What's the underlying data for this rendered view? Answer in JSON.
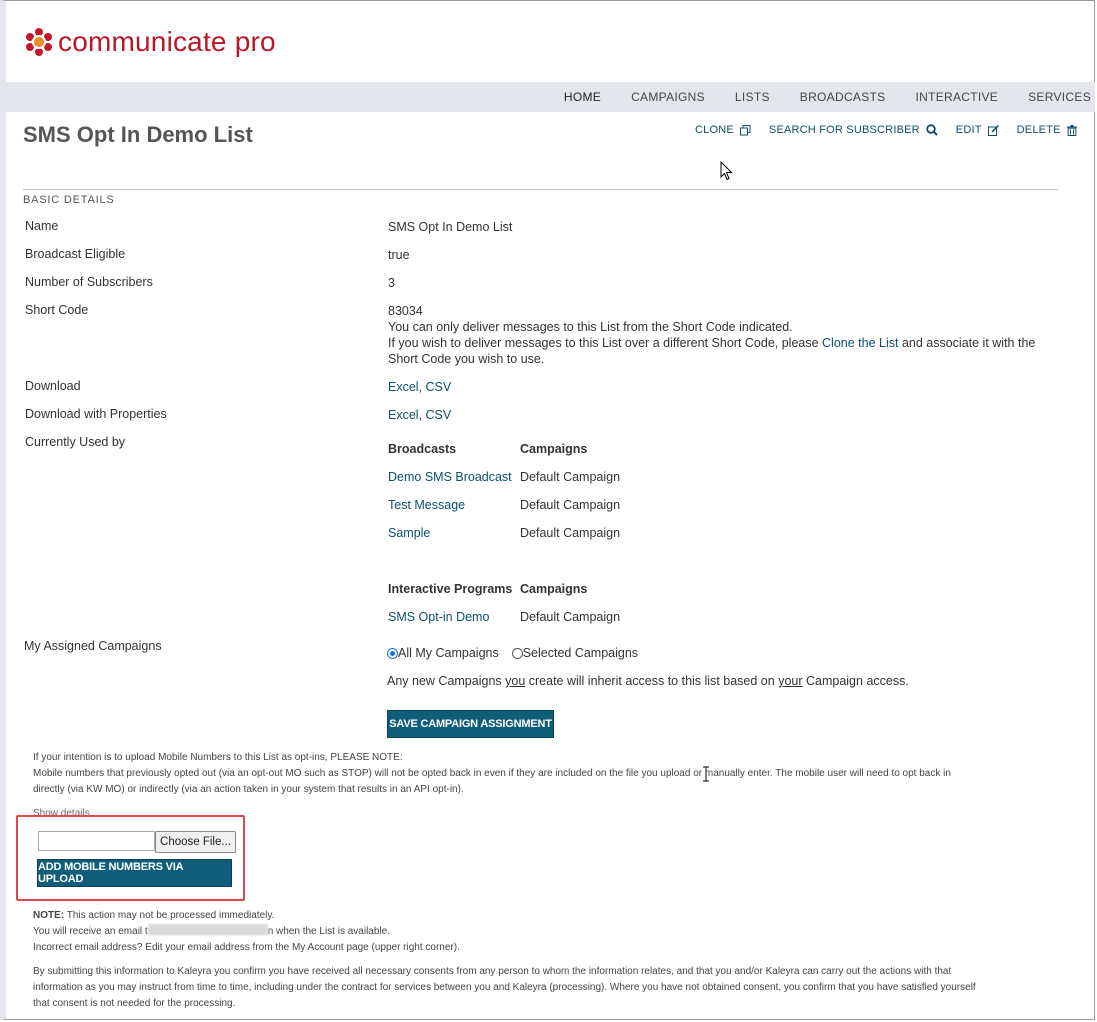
{
  "brand": {
    "name": "communicate pro",
    "accent": "#b8182a"
  },
  "nav": {
    "items": [
      "HOME",
      "CAMPAIGNS",
      "LISTS",
      "BROADCASTS",
      "INTERACTIVE",
      "SERVICES"
    ]
  },
  "page": {
    "title": "SMS Opt In Demo List"
  },
  "actions": {
    "clone": "CLONE",
    "search": "SEARCH FOR SUBSCRIBER",
    "edit": "EDIT",
    "delete": "DELETE"
  },
  "section": {
    "heading": "BASIC DETAILS"
  },
  "details": {
    "name_label": "Name",
    "name_value": "SMS Opt In Demo List",
    "eligible_label": "Broadcast Eligible",
    "eligible_value": "true",
    "subs_label": "Number of Subscribers",
    "subs_value": "3",
    "shortcode_label": "Short Code",
    "shortcode_value": "83034",
    "shortcode_note1": "You can only deliver messages to this List from the Short Code indicated.",
    "shortcode_note2a": "If you wish to deliver messages to this List over a different Short Code, please ",
    "shortcode_note2_link": "Clone the List",
    "shortcode_note2b": " and associate it with the",
    "shortcode_note3": "Short Code you wish to use.",
    "download_label": "Download",
    "download_excel": "Excel",
    "download_csv": "CSV",
    "download_props_label": "Download with Properties",
    "used_label": "Currently Used by",
    "broadcasts_header": "Broadcasts",
    "campaigns_header": "Campaigns",
    "broadcasts": [
      {
        "name": "Demo SMS Broadcast",
        "campaign": "Default Campaign"
      },
      {
        "name": "Test Message",
        "campaign": "Default Campaign"
      },
      {
        "name": "Sample",
        "campaign": "Default Campaign"
      }
    ],
    "interactive_header": "Interactive Programs",
    "interactive": [
      {
        "name": "SMS Opt-in Demo",
        "campaign": "Default Campaign"
      }
    ],
    "assigned_label": "My Assigned Campaigns",
    "radio_all": "All My Campaigns",
    "radio_selected": "Selected Campaigns",
    "inherit_a": "Any new Campaigns ",
    "inherit_you": "you",
    "inherit_b": " create will inherit access to this list based on ",
    "inherit_your": "your",
    "inherit_c": " Campaign access.",
    "save_button": "SAVE CAMPAIGN ASSIGNMENT"
  },
  "upload": {
    "note1": "If your intention is to upload Mobile Numbers to this List as opt-ins, PLEASE NOTE:",
    "note2": "Mobile numbers that previously opted out (via an opt-out MO such as STOP) will not be opted back in even if they are included on the file you upload or manually enter. The mobile user will need to opt back in",
    "note3": "directly (via KW MO) or indirectly (via an action taken in your system that results in an API opt-in).",
    "show_details": "Show details",
    "choose_file": "Choose File...",
    "add_button": "ADD MOBILE NUMBERS VIA UPLOAD",
    "note_label": "NOTE:",
    "note_text": " This action may not be processed immediately.",
    "email_a": "You will receive an email t",
    "email_b": "n when the List is available.",
    "incorrect": "Incorrect email address? Edit your email address from the My Account page (upper right corner).",
    "consent1": "By submitting this information to Kaleyra you confirm you have received all necessary consents from any person to whom the information relates, and that you and/or Kaleyra can carry out the actions with that",
    "consent2": "information as you may instruct from time to time, including under the contract for services between you and Kaleyra (processing). Where you have not obtained consent, you confirm that you have satisfied yourself",
    "consent3": "that consent is not needed for the processing."
  }
}
